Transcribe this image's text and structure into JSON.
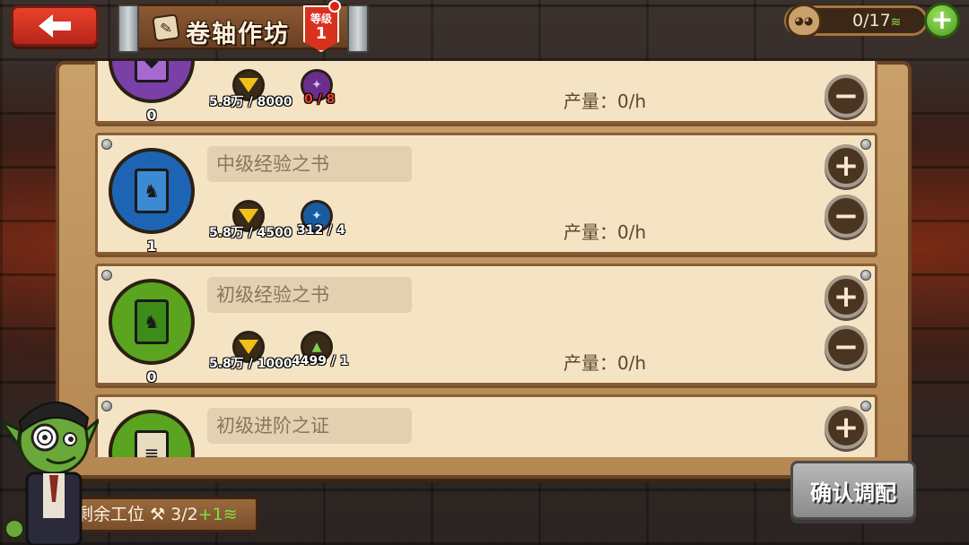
{
  "header": {
    "title": "卷轴作坊",
    "level_label": "等级",
    "level_value": "1",
    "worker_count": "0/17",
    "worker_boost": "≋"
  },
  "rows": [
    {
      "name": "",
      "count": "0",
      "gold": "5.8万 / 8000",
      "resource_have": "0",
      "resource_need": " / 8",
      "output": "产量：0/h",
      "color": "#7b3fa8"
    },
    {
      "name": "中级经验之书",
      "count": "1",
      "gold": "5.8万 / 4500",
      "resource": "312 / 4",
      "output": "产量：0/h",
      "color": "#1e64b4"
    },
    {
      "name": "初级经验之书",
      "count": "0",
      "gold": "5.8万 / 1000",
      "resource": "4499 / 1",
      "output": "产量：0/h",
      "color": "#5aa420"
    },
    {
      "name": "初级进阶之证",
      "color": "#5aa420"
    }
  ],
  "buttons": {
    "plus": "+",
    "minus": "−",
    "confirm": "确认调配",
    "top_plus": "+"
  },
  "footer": {
    "slots_label": "剩余工位",
    "slots_value": "3/2",
    "slots_bonus": "+1",
    "slots_boost": "≋"
  }
}
